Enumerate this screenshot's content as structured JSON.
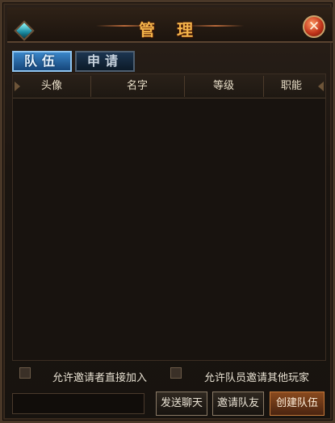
{
  "window": {
    "title": "管 理",
    "close_symbol": "✕"
  },
  "tabs": [
    {
      "label": "队伍",
      "active": true
    },
    {
      "label": "申请",
      "active": false
    }
  ],
  "table": {
    "columns": [
      "头像",
      "名字",
      "等级",
      "职能"
    ],
    "rows": []
  },
  "options": {
    "allow_invitee_join": {
      "label": "允许邀请者直接加入",
      "checked": false
    },
    "allow_member_invite": {
      "label": "允许队员邀请其他玩家",
      "checked": false
    }
  },
  "chat": {
    "placeholder": ""
  },
  "buttons": {
    "send_chat": "发送聊天",
    "invite_friend": "邀请队友",
    "create_team": "创建队伍"
  },
  "icons": {
    "window_gem": "gem-icon",
    "close": "close-icon",
    "header_left": "arrow-left-icon",
    "header_right": "arrow-right-icon"
  },
  "colors": {
    "title": "#f3b34a",
    "tab_active": "#3a86c9",
    "primary_button": "#8a4a1e"
  }
}
